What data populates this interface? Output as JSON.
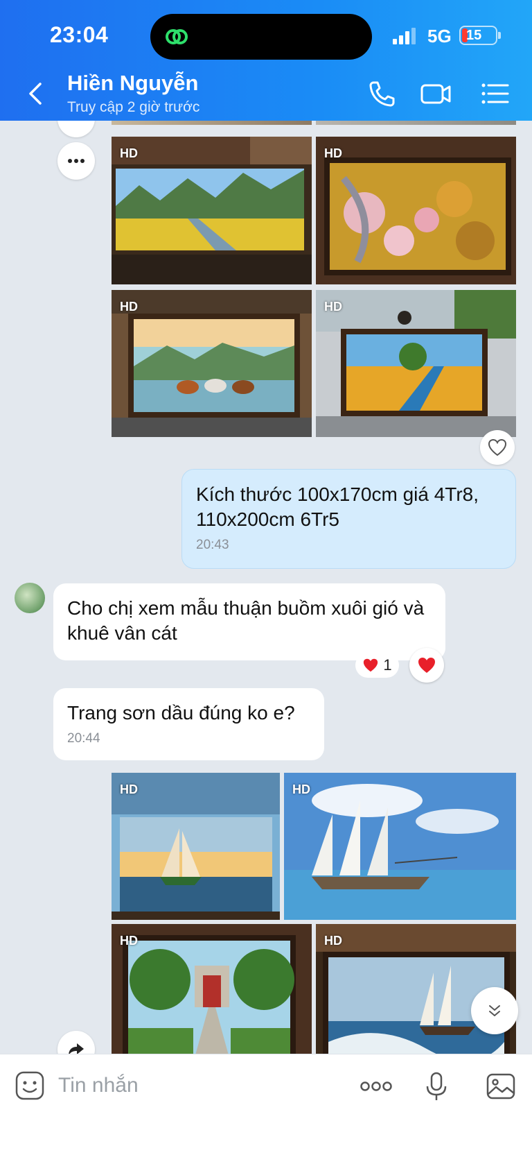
{
  "status_bar": {
    "time": "23:04",
    "network": "5G",
    "battery": "15"
  },
  "header": {
    "contact_name": "Hiền Nguyễn",
    "last_seen": "Truy cập 2 giờ trước",
    "icons": [
      "back-icon",
      "phone-icon",
      "video-icon",
      "menu-icon"
    ]
  },
  "photo_badge": "HD",
  "messages": [
    {
      "from": "me",
      "text": "Kích thước 100x170cm giá 4Tr8, 110x200cm 6Tr5",
      "time": "20:43"
    },
    {
      "from": "them",
      "text": "Cho chị xem mẫu thuận buồm xuôi gió và khuê vân cát",
      "reaction": {
        "emoji": "heart",
        "count": "1"
      }
    },
    {
      "from": "them",
      "text": "Trang sơn dầu đúng ko e?",
      "time": "20:44"
    }
  ],
  "input": {
    "placeholder": "Tin nhắn"
  },
  "colors": {
    "header": "#1a8cf6",
    "my_bubble": "#d5ecfd",
    "heart": "#e8202a"
  }
}
